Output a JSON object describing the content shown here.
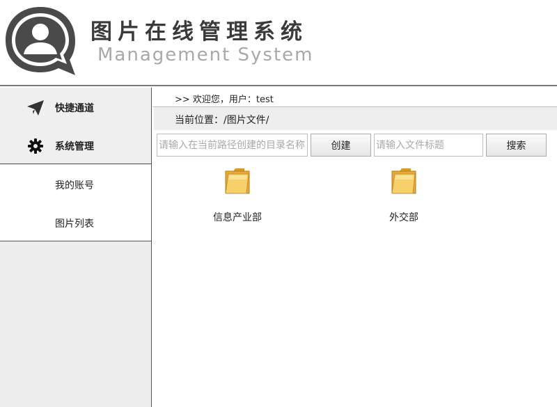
{
  "header": {
    "title_cn": "图片在线管理系统",
    "title_en": "Management System",
    "logo_icon": "user-chat-bubble-icon"
  },
  "sidebar": {
    "nav": [
      {
        "label": "快捷通道",
        "icon": "paper-plane-icon"
      },
      {
        "label": "系统管理",
        "icon": "gear-icon"
      }
    ],
    "sub_items": [
      {
        "label": "我的账号"
      },
      {
        "label": "图片列表"
      }
    ]
  },
  "main": {
    "welcome": ">> 欢迎您，用户：test",
    "location": "当前位置：/图片文件/",
    "toolbar": {
      "dir_input_placeholder": "请输入在当前路径创建的目录名称",
      "dir_input_value": "",
      "create_label": "创建",
      "search_input_placeholder": "请输入文件标题",
      "search_input_value": "",
      "search_label": "搜索"
    },
    "folders": [
      {
        "name": "信息产业部"
      },
      {
        "name": "外交部"
      }
    ]
  },
  "colors": {
    "header_border": "#7a7a7a",
    "sidebar_bg": "#ededed",
    "folder_yellow": "#f5c542",
    "placeholder": "#a9a9a9"
  }
}
